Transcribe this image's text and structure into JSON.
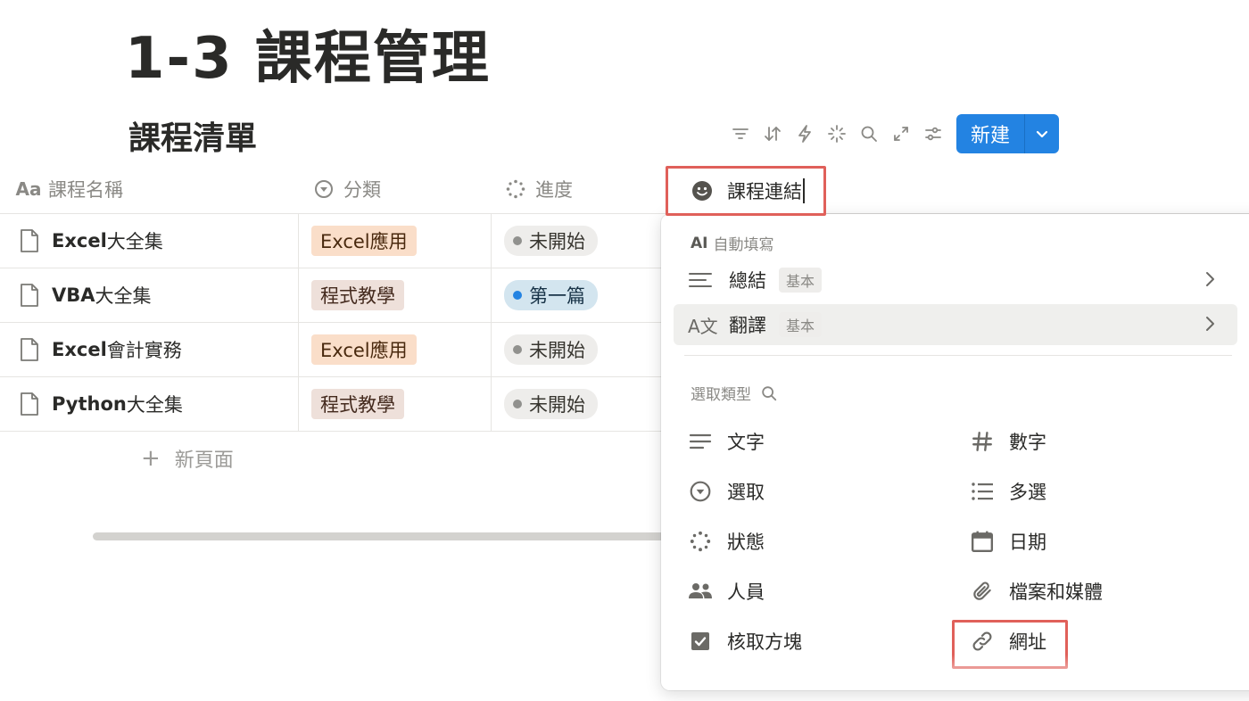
{
  "page": {
    "title": "1-3 課程管理"
  },
  "database": {
    "title": "課程清單",
    "new_button_label": "新建"
  },
  "toolbar": {
    "icons": [
      "filter-icon",
      "sort-icon",
      "lightning-icon",
      "sparkle-icon",
      "search-icon",
      "expand-icon",
      "settings-icon",
      "chevron-down-icon"
    ]
  },
  "table": {
    "columns": [
      {
        "label": "課程名稱",
        "icon": "Aa"
      },
      {
        "label": "分類",
        "icon": "select-icon"
      },
      {
        "label": "進度",
        "icon": "status-icon"
      }
    ],
    "rows": [
      {
        "name_en": "Excel",
        "name_zh": "大全集",
        "category": "Excel應用",
        "status": "未開始"
      },
      {
        "name_en": "VBA",
        "name_zh": "大全集",
        "category": "程式教學",
        "status": "第一篇"
      },
      {
        "name_en": "Excel",
        "name_zh": "會計實務",
        "category": "Excel應用",
        "status": "未開始"
      },
      {
        "name_en": "Python",
        "name_zh": "大全集",
        "category": "程式教學",
        "status": "未開始"
      }
    ],
    "new_page_label": "新頁面"
  },
  "colors": {
    "accent": "#2383e2",
    "highlight_border": "#e0605a",
    "tag_excel_bg": "#fadec9",
    "tag_excel_text": "#49290e",
    "tag_program_bg": "#eee0da",
    "tag_program_text": "#442a1e",
    "status_grey_bg": "#eeedeb",
    "status_grey_dot": "#91918e",
    "status_blue_bg": "#d3e5ef",
    "status_blue_dot": "#2383e2"
  },
  "property_editor": {
    "icon": "smiley-icon",
    "name_value": "課程連結"
  },
  "menu": {
    "ai_section_prefix": "AI",
    "ai_section_label": "自動填寫",
    "ai_items": [
      {
        "icon_text": "",
        "label": "總結",
        "badge": "基本"
      },
      {
        "icon_text": "A文",
        "label": "翻譯",
        "badge": "基本"
      }
    ],
    "type_section_label": "選取類型",
    "types": [
      {
        "label": "文字",
        "icon": "text-icon"
      },
      {
        "label": "數字",
        "icon": "hash-icon"
      },
      {
        "label": "選取",
        "icon": "select-icon"
      },
      {
        "label": "多選",
        "icon": "list-icon"
      },
      {
        "label": "狀態",
        "icon": "status-icon"
      },
      {
        "label": "日期",
        "icon": "calendar-icon"
      },
      {
        "label": "人員",
        "icon": "people-icon"
      },
      {
        "label": "檔案和媒體",
        "icon": "paperclip-icon"
      },
      {
        "label": "核取方塊",
        "icon": "checkbox-icon"
      },
      {
        "label": "網址",
        "icon": "link-icon"
      }
    ]
  }
}
